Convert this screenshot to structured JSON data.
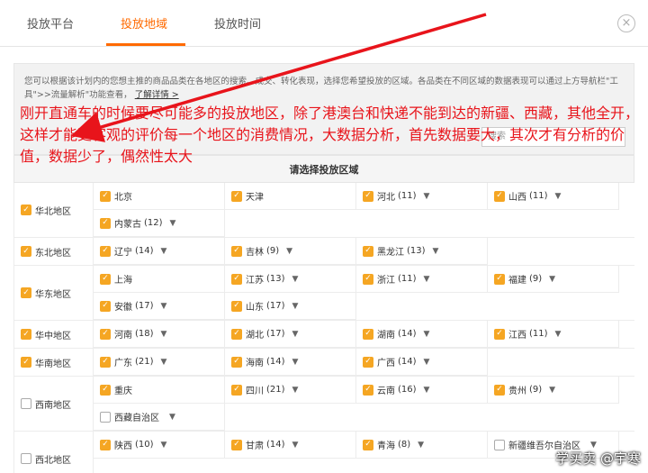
{
  "tabs": [
    {
      "label": "投放平台",
      "active": false
    },
    {
      "label": "投放地域",
      "active": true
    },
    {
      "label": "投放时间",
      "active": false
    }
  ],
  "close_glyph": "×",
  "notice": {
    "text": "您可以根据该计划内的您想主推的商品品类在各地区的搜索、成交、转化表现，选择您希望投放的区域。各品类在不同区域的数据表现可以通过上方导航栏\"工具\">>流量解析\"功能查看，",
    "link": "了解详情 >"
  },
  "search_placeholder": "搜索",
  "annotation": "刚开直通车的时候要尽可能多的投放地区，除了港澳台和快递不能到达的新疆、西藏，其他全开，这样才能更客观的评价每一个地区的消费情况，大数据分析，首先数据要大，其次才有分析的价值，数据少了，偶然性太大",
  "table": {
    "header": "请选择投放区域",
    "regions": [
      {
        "name": "华北地区",
        "checked": true,
        "provinces": [
          {
            "name": "北京",
            "count": "",
            "checked": true,
            "caret": false
          },
          {
            "name": "天津",
            "count": "",
            "checked": true,
            "caret": false
          },
          {
            "name": "河北",
            "count": "(11)",
            "checked": true,
            "caret": true
          },
          {
            "name": "山西",
            "count": "(11)",
            "checked": true,
            "caret": true
          },
          {
            "name": "内蒙古",
            "count": "(12)",
            "checked": true,
            "caret": true
          }
        ]
      },
      {
        "name": "东北地区",
        "checked": true,
        "provinces": [
          {
            "name": "辽宁",
            "count": "(14)",
            "checked": true,
            "caret": true
          },
          {
            "name": "吉林",
            "count": "(9)",
            "checked": true,
            "caret": true
          },
          {
            "name": "黑龙江",
            "count": "(13)",
            "checked": true,
            "caret": true
          }
        ]
      },
      {
        "name": "华东地区",
        "checked": true,
        "provinces": [
          {
            "name": "上海",
            "count": "",
            "checked": true,
            "caret": false
          },
          {
            "name": "江苏",
            "count": "(13)",
            "checked": true,
            "caret": true
          },
          {
            "name": "浙江",
            "count": "(11)",
            "checked": true,
            "caret": true
          },
          {
            "name": "福建",
            "count": "(9)",
            "checked": true,
            "caret": true
          },
          {
            "name": "安徽",
            "count": "(17)",
            "checked": true,
            "caret": true
          },
          {
            "name": "山东",
            "count": "(17)",
            "checked": true,
            "caret": true
          }
        ]
      },
      {
        "name": "华中地区",
        "checked": true,
        "provinces": [
          {
            "name": "河南",
            "count": "(18)",
            "checked": true,
            "caret": true
          },
          {
            "name": "湖北",
            "count": "(17)",
            "checked": true,
            "caret": true
          },
          {
            "name": "湖南",
            "count": "(14)",
            "checked": true,
            "caret": true
          },
          {
            "name": "江西",
            "count": "(11)",
            "checked": true,
            "caret": true
          }
        ]
      },
      {
        "name": "华南地区",
        "checked": true,
        "provinces": [
          {
            "name": "广东",
            "count": "(21)",
            "checked": true,
            "caret": true
          },
          {
            "name": "海南",
            "count": "(14)",
            "checked": true,
            "caret": true
          },
          {
            "name": "广西",
            "count": "(14)",
            "checked": true,
            "caret": true
          }
        ]
      },
      {
        "name": "西南地区",
        "checked": false,
        "provinces": [
          {
            "name": "重庆",
            "count": "",
            "checked": true,
            "caret": false
          },
          {
            "name": "四川",
            "count": "(21)",
            "checked": true,
            "caret": true
          },
          {
            "name": "云南",
            "count": "(16)",
            "checked": true,
            "caret": true
          },
          {
            "name": "贵州",
            "count": "(9)",
            "checked": true,
            "caret": true
          },
          {
            "name": "西藏自治区",
            "count": "",
            "checked": false,
            "caret": true
          }
        ]
      },
      {
        "name": "西北地区",
        "checked": false,
        "provinces": [
          {
            "name": "陕西",
            "count": "(10)",
            "checked": true,
            "caret": true
          },
          {
            "name": "甘肃",
            "count": "(14)",
            "checked": true,
            "caret": true
          },
          {
            "name": "青海",
            "count": "(8)",
            "checked": true,
            "caret": true
          },
          {
            "name": "新疆维吾尔自治区",
            "count": "",
            "checked": false,
            "caret": true
          }
        ]
      }
    ]
  },
  "watermark": "学买卖 @宇寒",
  "colors": {
    "accent": "#ff6a00",
    "checkbox": "#f5a623",
    "annotation": "#e8141b"
  },
  "icons": {
    "checked": "check-icon",
    "caret": "caret-down-icon",
    "close": "close-icon"
  }
}
